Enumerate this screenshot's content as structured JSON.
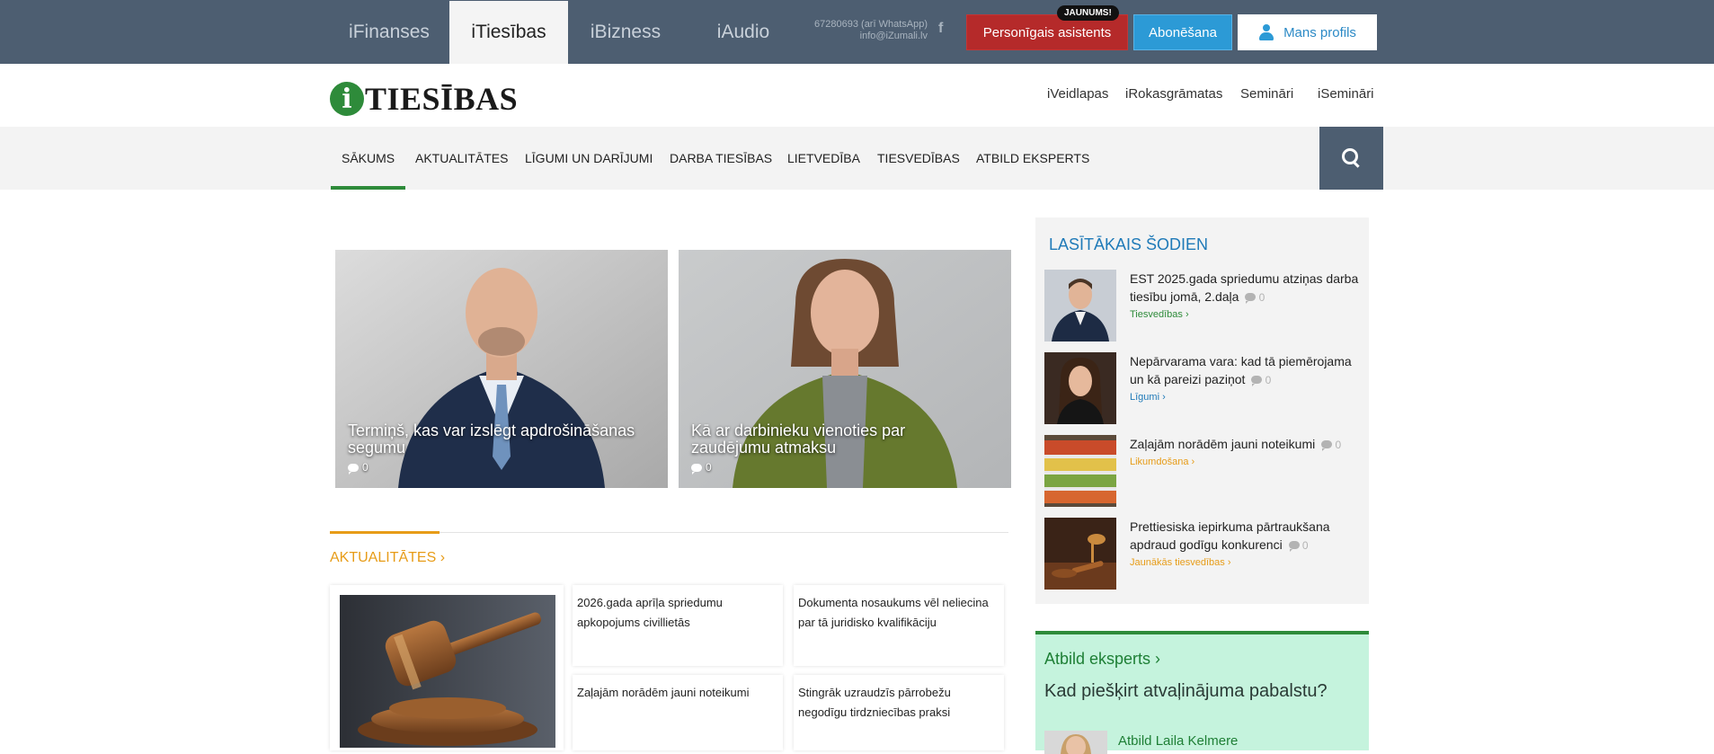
{
  "top_bar": {
    "site_tabs": [
      {
        "label": "iFinanses"
      },
      {
        "label": "iTiesības"
      },
      {
        "label": "iBizness"
      },
      {
        "label": "iAudio"
      }
    ],
    "contact_phone": "67280693 (arī WhatsApp)",
    "contact_email": "info@iZumali.lv",
    "facebook_glyph": "f",
    "assistant_button": "Personīgais asistents",
    "new_badge": "JAUNUMS!",
    "subscribe_button": "Abonēšana",
    "profile_button": "Mans profils"
  },
  "logo": {
    "letter": "i",
    "text": "TIESĪBAS"
  },
  "sub_nav": [
    {
      "label": "iVeidlapas"
    },
    {
      "label": "iRokasgrāmatas"
    },
    {
      "label": "Semināri"
    },
    {
      "label": "iSemināri"
    }
  ],
  "main_nav": [
    {
      "label": "SĀKUMS"
    },
    {
      "label": "AKTUALITĀTES"
    },
    {
      "label": "LĪGUMI UN DARĪJUMI"
    },
    {
      "label": "DARBA TIESĪBAS"
    },
    {
      "label": "LIETVEDĪBA"
    },
    {
      "label": "TIESVEDĪBAS"
    },
    {
      "label": "ATBILD EKSPERTS"
    }
  ],
  "hero_articles": [
    {
      "title": "Termiņš, kas var izslēgt apdrošināšanas segumu",
      "comments": "0"
    },
    {
      "title": "Kā ar darbinieku vienoties par zaudējumu atmaksu",
      "comments": "0"
    }
  ],
  "news_section": {
    "title": "AKTUALITĀTES ›",
    "articles": [
      {
        "title": "2026.gada aprīļa spriedumu apkopojums civillietās"
      },
      {
        "title": "Dokumenta nosaukums vēl neliecina par tā juridisko kvalifikāciju"
      },
      {
        "title": "Zaļajām norādēm jauni noteikumi"
      },
      {
        "title": "Stingrāk uzraudzīs pārrobežu negodīgu tirdzniecības praksi"
      }
    ]
  },
  "popular": {
    "title": "LASĪTĀKAIS ŠODIEN",
    "items": [
      {
        "title": "EST 2025.gada spriedumu atziņas darba tiesību jomā, 2.daļa",
        "comments": "0",
        "category": "Tiesvedības  ›",
        "category_color": "#2e8b3a"
      },
      {
        "title": "Nepārvarama vara: kad tā piemērojama un kā pareizi paziņot",
        "comments": "0",
        "category": "Līgumi  ›",
        "category_color": "#1f7ab8"
      },
      {
        "title": "Zaļajām norādēm jauni noteikumi",
        "comments": "0",
        "category": "Likumdošana  ›",
        "category_color": "#e79c18"
      },
      {
        "title": "Prettiesiska iepirkuma pārtraukšana apdraud godīgu konkurenci",
        "comments": "0",
        "category": "Jaunākās tiesvedības  ›",
        "category_color": "#e79c18"
      }
    ]
  },
  "expert": {
    "title": "Atbild eksperts ›",
    "question": "Kad piešķirt atvaļinājuma pabalstu?",
    "answerer": "Atbild Laila Kelmere"
  },
  "colors": {
    "topbar": "#4d5e71",
    "green_accent": "#2e8b3a",
    "orange_accent": "#e79c18",
    "blue_accent": "#1f7ab8",
    "red_button": "#b52a2a",
    "blue_button": "#2c9ad6"
  }
}
